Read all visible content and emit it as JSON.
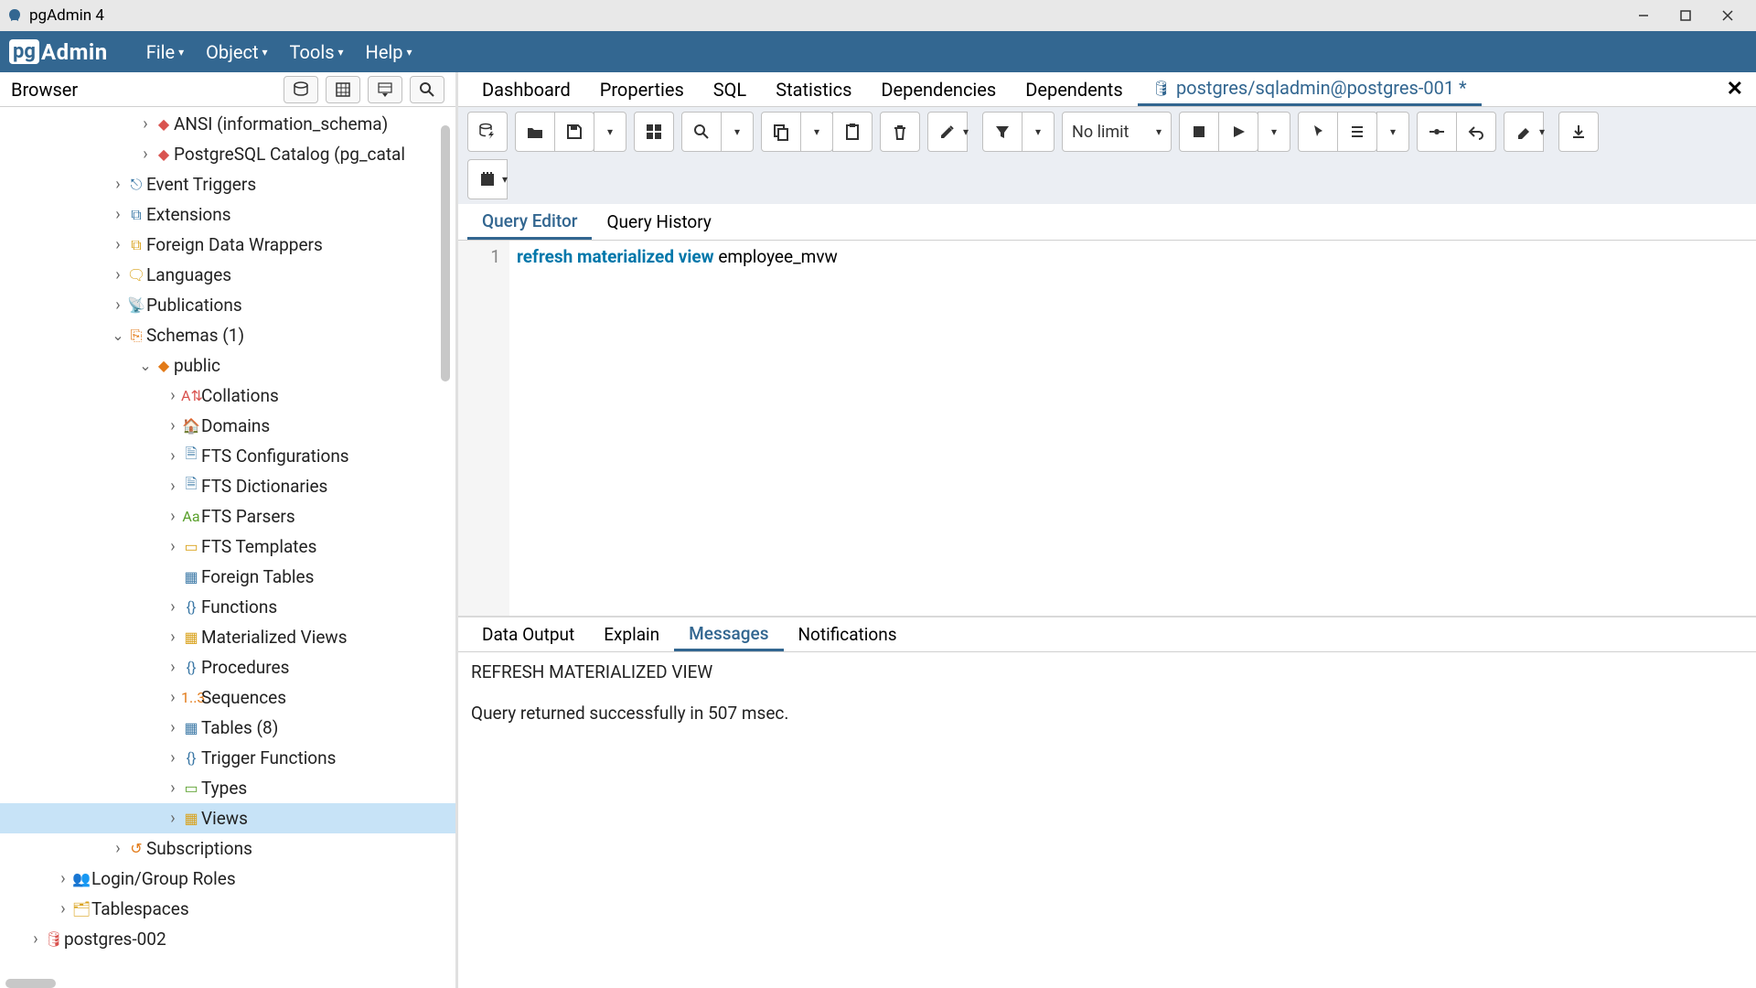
{
  "window": {
    "title": "pgAdmin 4"
  },
  "menubar": {
    "items": [
      "File",
      "Object",
      "Tools",
      "Help"
    ]
  },
  "browser": {
    "title": "Browser",
    "tree": [
      {
        "indent": 5,
        "caret": "closed",
        "icon": "◆",
        "iconcls": "ic-red",
        "label": "ANSI (information_schema)"
      },
      {
        "indent": 5,
        "caret": "closed",
        "icon": "◆",
        "iconcls": "ic-red",
        "label": "PostgreSQL Catalog (pg_catal"
      },
      {
        "indent": 4,
        "caret": "closed",
        "icon": "⎋",
        "iconcls": "ic-blue",
        "label": "Event Triggers"
      },
      {
        "indent": 4,
        "caret": "closed",
        "icon": "⧉",
        "iconcls": "ic-blue",
        "label": "Extensions"
      },
      {
        "indent": 4,
        "caret": "closed",
        "icon": "⧉",
        "iconcls": "ic-yellow",
        "label": "Foreign Data Wrappers"
      },
      {
        "indent": 4,
        "caret": "closed",
        "icon": "🗨",
        "iconcls": "ic-yellow",
        "label": "Languages"
      },
      {
        "indent": 4,
        "caret": "closed",
        "icon": "📡",
        "iconcls": "ic-blue",
        "label": "Publications"
      },
      {
        "indent": 4,
        "caret": "open",
        "icon": "⎘",
        "iconcls": "ic-orange",
        "label": "Schemas (1)"
      },
      {
        "indent": 5,
        "caret": "open",
        "icon": "◆",
        "iconcls": "ic-orange",
        "label": "public"
      },
      {
        "indent": 6,
        "caret": "closed",
        "icon": "A⇅",
        "iconcls": "ic-red",
        "label": "Collations"
      },
      {
        "indent": 6,
        "caret": "closed",
        "icon": "🏠",
        "iconcls": "ic-orange",
        "label": "Domains"
      },
      {
        "indent": 6,
        "caret": "closed",
        "icon": "🗎",
        "iconcls": "ic-blue",
        "label": "FTS Configurations"
      },
      {
        "indent": 6,
        "caret": "closed",
        "icon": "🗎",
        "iconcls": "ic-blue",
        "label": "FTS Dictionaries"
      },
      {
        "indent": 6,
        "caret": "closed",
        "icon": "Aa",
        "iconcls": "ic-green",
        "label": "FTS Parsers"
      },
      {
        "indent": 6,
        "caret": "closed",
        "icon": "▭",
        "iconcls": "ic-yellow",
        "label": "FTS Templates"
      },
      {
        "indent": 6,
        "caret": "none",
        "icon": "▦",
        "iconcls": "ic-blue",
        "label": "Foreign Tables"
      },
      {
        "indent": 6,
        "caret": "closed",
        "icon": "{}",
        "iconcls": "ic-blue",
        "label": "Functions"
      },
      {
        "indent": 6,
        "caret": "closed",
        "icon": "▦",
        "iconcls": "ic-yellow",
        "label": "Materialized Views"
      },
      {
        "indent": 6,
        "caret": "closed",
        "icon": "{}",
        "iconcls": "ic-blue",
        "label": "Procedures"
      },
      {
        "indent": 6,
        "caret": "closed",
        "icon": "1..3",
        "iconcls": "ic-orange",
        "label": "Sequences"
      },
      {
        "indent": 6,
        "caret": "closed",
        "icon": "▦",
        "iconcls": "ic-blue",
        "label": "Tables (8)"
      },
      {
        "indent": 6,
        "caret": "closed",
        "icon": "{}",
        "iconcls": "ic-blue",
        "label": "Trigger Functions"
      },
      {
        "indent": 6,
        "caret": "closed",
        "icon": "▭",
        "iconcls": "ic-green",
        "label": "Types"
      },
      {
        "indent": 6,
        "caret": "closed",
        "icon": "▦",
        "iconcls": "ic-yellow",
        "label": "Views",
        "selected": true
      },
      {
        "indent": 4,
        "caret": "closed",
        "icon": "↺",
        "iconcls": "ic-orange",
        "label": "Subscriptions"
      },
      {
        "indent": 2,
        "caret": "closed",
        "icon": "👥",
        "iconcls": "ic-orange",
        "label": "Login/Group Roles"
      },
      {
        "indent": 2,
        "caret": "closed",
        "icon": "🗂",
        "iconcls": "ic-yellow",
        "label": "Tablespaces"
      },
      {
        "indent": 1,
        "caret": "closed",
        "icon": "🛢",
        "iconcls": "ic-red",
        "label": "postgres-002"
      }
    ]
  },
  "main_tabs": {
    "items": [
      "Dashboard",
      "Properties",
      "SQL",
      "Statistics",
      "Dependencies",
      "Dependents"
    ],
    "conn_tab": "postgres/sqladmin@postgres-001 *"
  },
  "toolbar": {
    "limit": "No limit"
  },
  "editor_tabs": {
    "items": [
      "Query Editor",
      "Query History"
    ],
    "active": 0
  },
  "editor": {
    "line_no": "1",
    "tokens": {
      "kw1": "refresh",
      "kw2": "materialized",
      "kw3": "view",
      "ident": "employee_mvw"
    }
  },
  "output_tabs": {
    "items": [
      "Data Output",
      "Explain",
      "Messages",
      "Notifications"
    ],
    "active": 2
  },
  "messages": {
    "line1": "REFRESH MATERIALIZED VIEW",
    "line2": "Query returned successfully in 507 msec."
  }
}
